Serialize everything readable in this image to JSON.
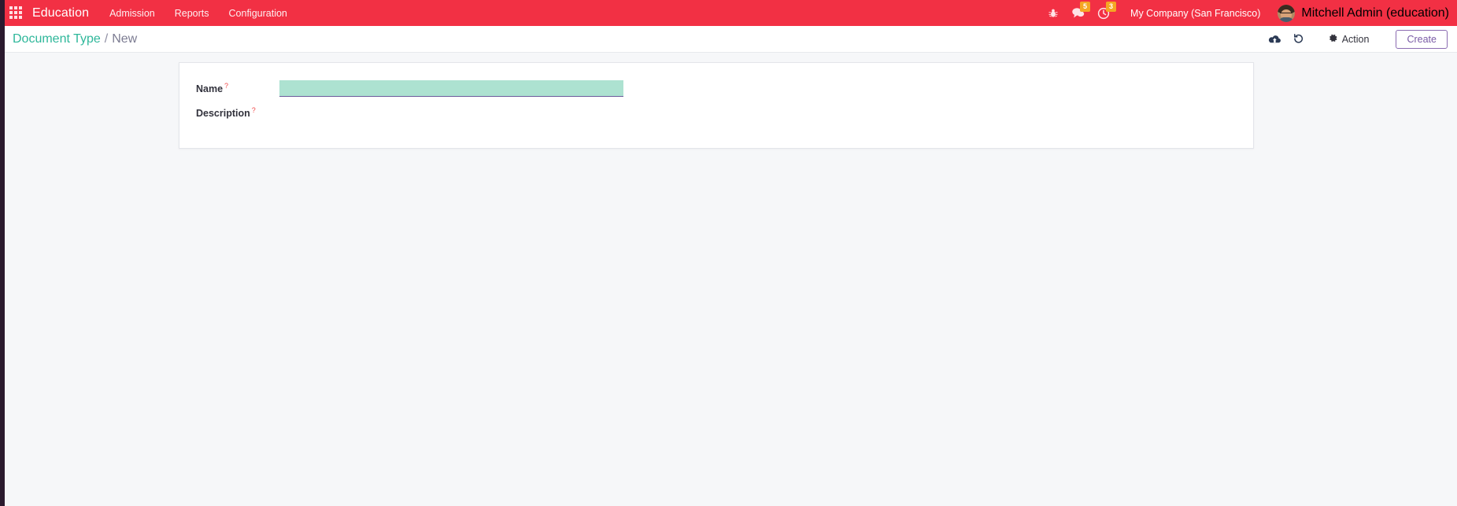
{
  "navbar": {
    "apps_icon": "apps-grid-icon",
    "brand": "Education",
    "menu_items": [
      {
        "label": "Admission"
      },
      {
        "label": "Reports"
      },
      {
        "label": "Configuration"
      }
    ],
    "system_icons": [
      {
        "name": "bug-icon",
        "badge": ""
      },
      {
        "name": "messages-icon",
        "badge": "5"
      },
      {
        "name": "activities-clock-icon",
        "badge": "3"
      }
    ],
    "company": "My Company (San Francisco)",
    "user": "Mitchell Admin (education)",
    "colors": {
      "navbar_bg": "#f23044",
      "badge_bg": "#f5a623"
    }
  },
  "control_panel": {
    "breadcrumb": {
      "parent": "Document Type",
      "separator": "/",
      "current": "New"
    },
    "save_icon": "cloud-upload-icon",
    "discard_icon": "undo-icon",
    "action": {
      "icon": "gear-icon",
      "label": "Action"
    },
    "create_label": "Create",
    "colors": {
      "breadcrumb_parent": "#2eb79a",
      "breadcrumb_current": "#7c7c92",
      "create_border": "#8b6bb1",
      "create_text": "#7a5ba6"
    }
  },
  "form": {
    "fields": [
      {
        "label": "Name",
        "help": "?",
        "value": "",
        "placeholder": "",
        "required": true
      },
      {
        "label": "Description",
        "help": "?",
        "value": "",
        "placeholder": "",
        "required": false
      }
    ],
    "colors": {
      "required_field_bg": "#ade2d1",
      "field_underline": "#6b5b9b",
      "sheet_bg": "#ffffff",
      "page_bg": "#f6f7f9"
    }
  }
}
